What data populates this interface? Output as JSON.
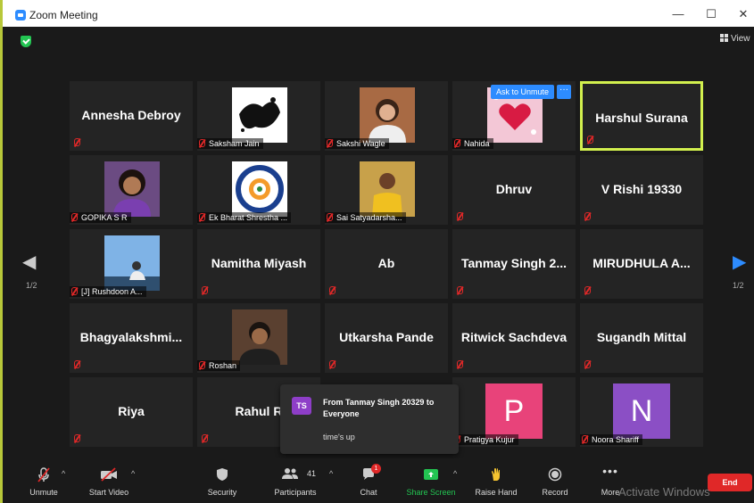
{
  "window": {
    "title": "Zoom Meeting",
    "controls": {
      "minimize": "—",
      "maximize": "☐",
      "close": "✕"
    }
  },
  "top": {
    "view_label": "View"
  },
  "pagination": {
    "left_page": "1/2",
    "right_page": "1/2"
  },
  "tile_actions": {
    "ask_to_unmute": "Ask to Unmute",
    "more": "···"
  },
  "participants": [
    {
      "name": "Annesha Debroy",
      "label": "",
      "type": "name"
    },
    {
      "name": "",
      "label": "Saksham Jain",
      "type": "photo",
      "photo": "ink"
    },
    {
      "name": "",
      "label": "Sakshi Wagle",
      "type": "photo",
      "photo": "woman"
    },
    {
      "name": "",
      "label": "Nahida",
      "type": "photo",
      "photo": "hearts"
    },
    {
      "name": "Harshul Surana",
      "label": "",
      "type": "name",
      "active": true
    },
    {
      "name": "",
      "label": "GOPIKA S R",
      "type": "photo",
      "photo": "girl"
    },
    {
      "name": "",
      "label": "Ek Bharat Shrestha ...",
      "type": "photo",
      "photo": "logo"
    },
    {
      "name": "",
      "label": "Sai Satyadarsha...",
      "type": "photo",
      "photo": "boy"
    },
    {
      "name": "Dhruv",
      "label": "",
      "type": "name"
    },
    {
      "name": "V Rishi 19330",
      "label": "",
      "type": "name"
    },
    {
      "name": "",
      "label": "[J] Rushdoon A...",
      "type": "photo",
      "photo": "sky"
    },
    {
      "name": "Namitha Miyash",
      "label": "",
      "type": "name"
    },
    {
      "name": "Ab",
      "label": "",
      "type": "name"
    },
    {
      "name": "Tanmay Singh 2...",
      "label": "",
      "type": "name"
    },
    {
      "name": "MIRUDHULA A...",
      "label": "",
      "type": "name"
    },
    {
      "name": "Bhagyalakshmi...",
      "label": "",
      "type": "name"
    },
    {
      "name": "",
      "label": "Roshan",
      "type": "photo",
      "photo": "man"
    },
    {
      "name": "Utkarsha Pande",
      "label": "",
      "type": "name"
    },
    {
      "name": "Ritwick Sachdeva",
      "label": "",
      "type": "name"
    },
    {
      "name": "Sugandh Mittal",
      "label": "",
      "type": "name"
    },
    {
      "name": "Riya",
      "label": "",
      "type": "name"
    },
    {
      "name": "Rahul R",
      "label": "",
      "type": "name"
    },
    {
      "name": "",
      "label": "",
      "type": "hidden"
    },
    {
      "name": "",
      "label": "Pratigya Kujur",
      "type": "letter",
      "letter": "P",
      "color": "#e8437a"
    },
    {
      "name": "",
      "label": "Noora Shariff",
      "type": "letter",
      "letter": "N",
      "color": "#8b4fc5"
    }
  ],
  "chat_popup": {
    "initials": "TS",
    "from": "From Tanmay Singh 20329 to Everyone",
    "message": "time's up"
  },
  "toolbar": {
    "unmute": "Unmute",
    "start_video": "Start Video",
    "security": "Security",
    "participants": "Participants",
    "participants_count": "41",
    "chat": "Chat",
    "chat_badge": "1",
    "share_screen": "Share Screen",
    "raise_hand": "Raise Hand",
    "record": "Record",
    "more": "More",
    "end": "End"
  },
  "watermark": "Activate Windows",
  "colors": {
    "accent": "#2d8cff",
    "active_speaker": "#d2f04e",
    "end": "#e02828",
    "share": "#23c552"
  }
}
